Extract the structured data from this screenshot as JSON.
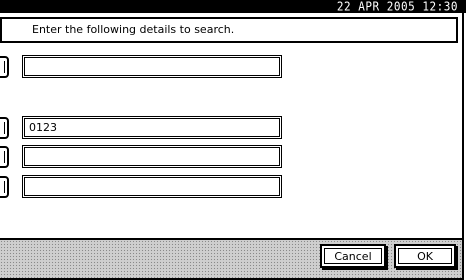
{
  "status_bar": {
    "datetime": "22 APR   2005 12:30"
  },
  "instruction": {
    "text": "Enter the following details to search."
  },
  "fields": [
    {
      "value": ""
    },
    {
      "value": "0123"
    },
    {
      "value": ""
    },
    {
      "value": ""
    }
  ],
  "buttons": {
    "cancel_label": "Cancel",
    "ok_label": "OK"
  },
  "colors": {
    "background": "#ffffff",
    "border": "#000000",
    "bottom_bar": "#cfcfcf"
  }
}
